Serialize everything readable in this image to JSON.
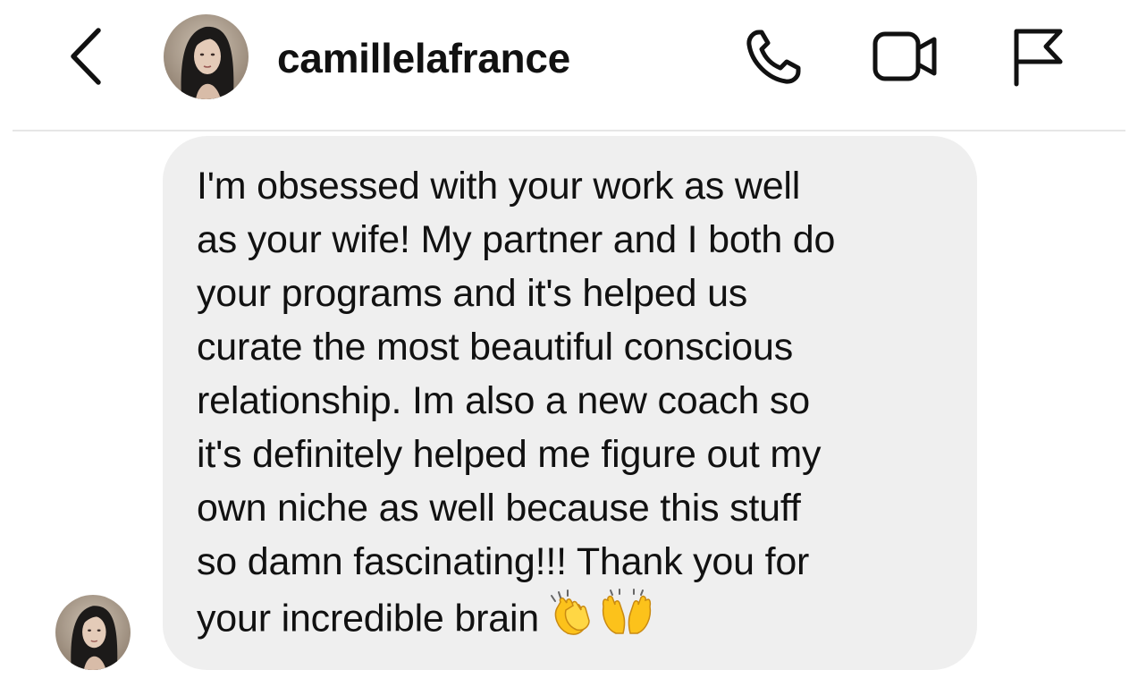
{
  "header": {
    "username": "camillelafrance",
    "icons": {
      "back": "chevron-left-icon",
      "call": "phone-icon",
      "video": "video-camera-icon",
      "report": "flag-icon"
    }
  },
  "message": {
    "text": "I'm obsessed with your work as well\nas your wife! My partner and I both do\nyour programs and it's helped us\ncurate the most beautiful conscious\nrelationship. Im also a new coach so\nit's definitely helped me figure out my\nown niche as well because this stuff\nso damn fascinating!!! Thank you for\nyour incredible brain",
    "emojis": [
      "👏",
      "🙌"
    ]
  },
  "colors": {
    "bubble": "#efefef",
    "text": "#111111",
    "divider": "#e6e6e6"
  }
}
